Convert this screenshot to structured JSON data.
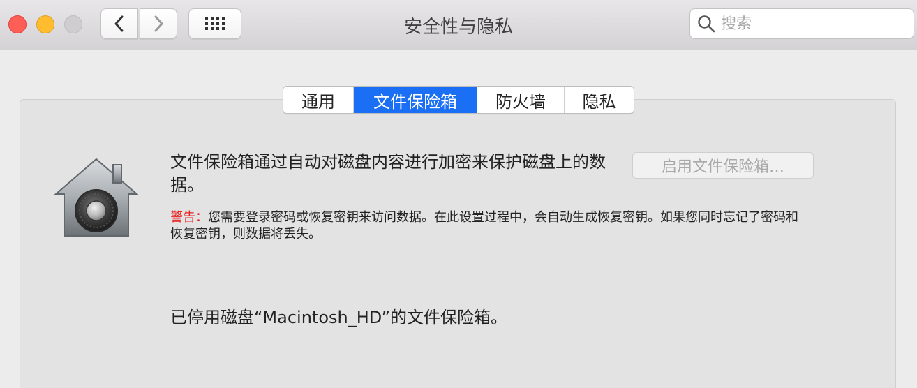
{
  "window": {
    "title": "安全性与隐私"
  },
  "toolbar": {
    "back_icon": "chevron-left-icon",
    "forward_icon": "chevron-right-icon",
    "grid_icon": "grid-icon",
    "search": {
      "value": "",
      "placeholder": "搜索"
    }
  },
  "tabs": [
    {
      "label": "通用",
      "active": false
    },
    {
      "label": "文件保险箱",
      "active": true
    },
    {
      "label": "防火墙",
      "active": false
    },
    {
      "label": "隐私",
      "active": false
    }
  ],
  "filevault": {
    "description": "文件保险箱通过自动对磁盘内容进行加密来保护磁盘上的数据。",
    "warning_label": "警告：",
    "warning_text": "您需要登录密码或恢复密钥来访问数据。在此设置过程中，会自动生成恢复密钥。如果您同时忘记了密码和恢复密钥，则数据将丢失。",
    "enable_button": "启用文件保险箱…",
    "status": "已停用磁盘“Macintosh_HD”的文件保险箱。"
  },
  "colors": {
    "accent": "#1a6ff4",
    "warning": "#e8221f",
    "close": "#fd5f57",
    "minimize": "#febc2e"
  }
}
